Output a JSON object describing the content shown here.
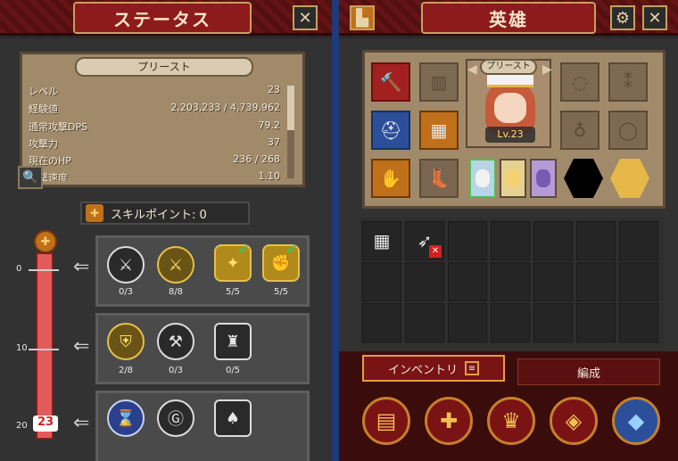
{
  "status_window": {
    "title": "ステータス",
    "close_icon": "close-icon",
    "class_name": "プリースト",
    "stats": [
      {
        "label": "レベル",
        "value": "23"
      },
      {
        "label": "経験値",
        "value": "2,203,233 / 4,739,962"
      },
      {
        "label": "通常攻撃DPS",
        "value": "79.2"
      },
      {
        "label": "攻撃力",
        "value": "37"
      },
      {
        "label": "現在のHP",
        "value": "236 / 268"
      },
      {
        "label": "攻撃速度",
        "value": "1.10"
      }
    ],
    "skill_points_label": "スキルポイント: 0",
    "current_level": "23",
    "tiers": [
      {
        "label": "0",
        "skills": [
          {
            "icon": "crossed-swords-icon",
            "count": "0/3",
            "style": "plain",
            "checked": false
          },
          {
            "icon": "crossed-blades-icon",
            "count": "8/8",
            "style": "gold",
            "checked": false
          },
          {
            "icon": "gold-emblem-icon",
            "count": "5/5",
            "style": "goldbig",
            "checked": true
          },
          {
            "icon": "gold-fist-icon",
            "count": "5/5",
            "style": "goldbig",
            "checked": true
          }
        ]
      },
      {
        "label": "10",
        "skills": [
          {
            "icon": "shield-icon",
            "count": "2/8",
            "style": "gold",
            "checked": false
          },
          {
            "icon": "axe-icon",
            "count": "0/3",
            "style": "plain",
            "checked": false
          },
          {
            "icon": "fortress-icon",
            "count": "0/5",
            "style": "plain",
            "checked": false
          }
        ]
      },
      {
        "label": "20",
        "skills": [
          {
            "icon": "hourglass-icon",
            "count": "",
            "style": "blue",
            "checked": false
          },
          {
            "icon": "rune-icon",
            "count": "",
            "style": "plain",
            "checked": false
          },
          {
            "icon": "spade-icon",
            "count": "",
            "style": "plain",
            "checked": false
          }
        ]
      }
    ]
  },
  "hero_window": {
    "title": "英雄",
    "portrait_class": "プリースト",
    "portrait_level": "Lv.23",
    "tabs": {
      "inventory": "インベントリ",
      "party": "編成"
    }
  }
}
